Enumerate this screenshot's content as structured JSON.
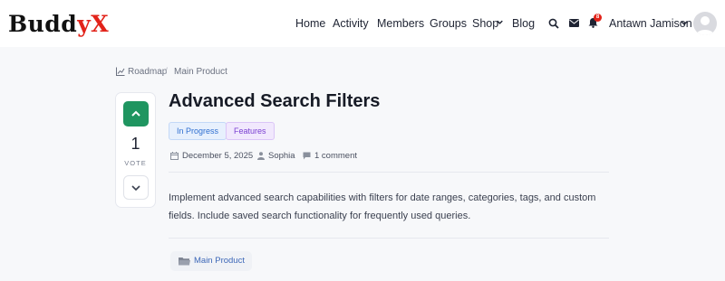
{
  "brand": {
    "name_main": "Budd",
    "name_tail": "yX"
  },
  "nav": {
    "items": [
      "Home",
      "Activity",
      "Members",
      "Groups",
      "Shop",
      "Blog"
    ],
    "notification_count": "8",
    "user_name": "Antawn Jamison"
  },
  "breadcrumb": {
    "root": "Roadmap",
    "separator": "/",
    "current": "Main Product"
  },
  "vote": {
    "count": "1",
    "label": "VOTE"
  },
  "post": {
    "title": "Advanced Search Filters",
    "tags": [
      "In Progress",
      "Features"
    ],
    "date": "December 5, 2025",
    "author": "Sophia",
    "comments": "1 comment",
    "description": "Implement advanced search capabilities with filters for date ranges, categories, tags, and custom fields. Include saved search functionality for frequently used queries.",
    "category": "Main Product"
  },
  "colors": {
    "accent_green": "#1f9560",
    "brand_red": "#e2231a",
    "tag_blue": "#2f6fd0",
    "tag_purple": "#7a3fd1"
  },
  "icons": [
    "search-icon",
    "mail-icon",
    "bell-icon",
    "chevron-down-icon",
    "chart-icon",
    "calendar-icon",
    "user-icon",
    "comment-icon",
    "folder-icon",
    "chevron-up-icon"
  ]
}
